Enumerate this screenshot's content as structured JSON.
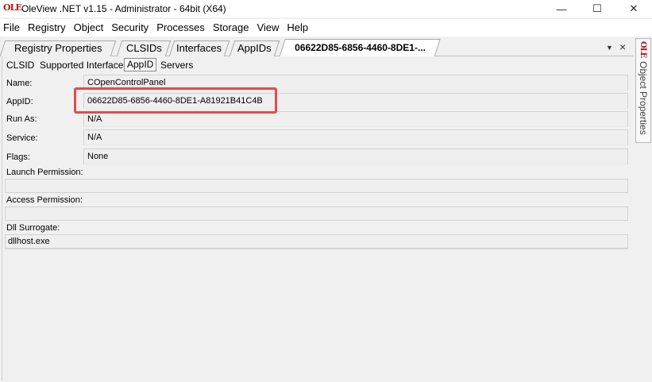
{
  "window": {
    "title": "OleView .NET v1.15 - Administrator - 64bit (X64)",
    "app_icon_text": "OLE",
    "minimize_glyph": "—",
    "maximize_glyph": "☐",
    "close_glyph": "✕"
  },
  "menu": [
    "File",
    "Registry",
    "Object",
    "Security",
    "Processes",
    "Storage",
    "View",
    "Help"
  ],
  "top_tabs": [
    "Registry Properties",
    "CLSIDs",
    "Interfaces",
    "AppIDs",
    "06622D85-6856-4460-8DE1-..."
  ],
  "tab_controls": {
    "dropdown_glyph": "▼",
    "close_glyph": "×"
  },
  "dock": {
    "label": "Object Properties",
    "icon_text": "OLE"
  },
  "sub_tabs": [
    "CLSID",
    "Supported Interfaces",
    "AppID",
    "Servers"
  ],
  "fields": {
    "name_label": "Name:",
    "name_value": "COpenControlPanel",
    "appid_label": "AppID:",
    "appid_value": "06622D85-6856-4460-8DE1-A81921B41C4B",
    "runas_label": "Run As:",
    "runas_value": "N/A",
    "service_label": "Service:",
    "service_value": "N/A",
    "flags_label": "Flags:",
    "flags_value": "None",
    "launch_label": "Launch Permission:",
    "launch_value": "",
    "access_label": "Access Permission:",
    "access_value": "",
    "dll_label": "Dll Surrogate:",
    "dll_value": "dllhost.exe"
  },
  "colors": {
    "highlight": "#e8494c",
    "icon_red": "#b01818"
  }
}
